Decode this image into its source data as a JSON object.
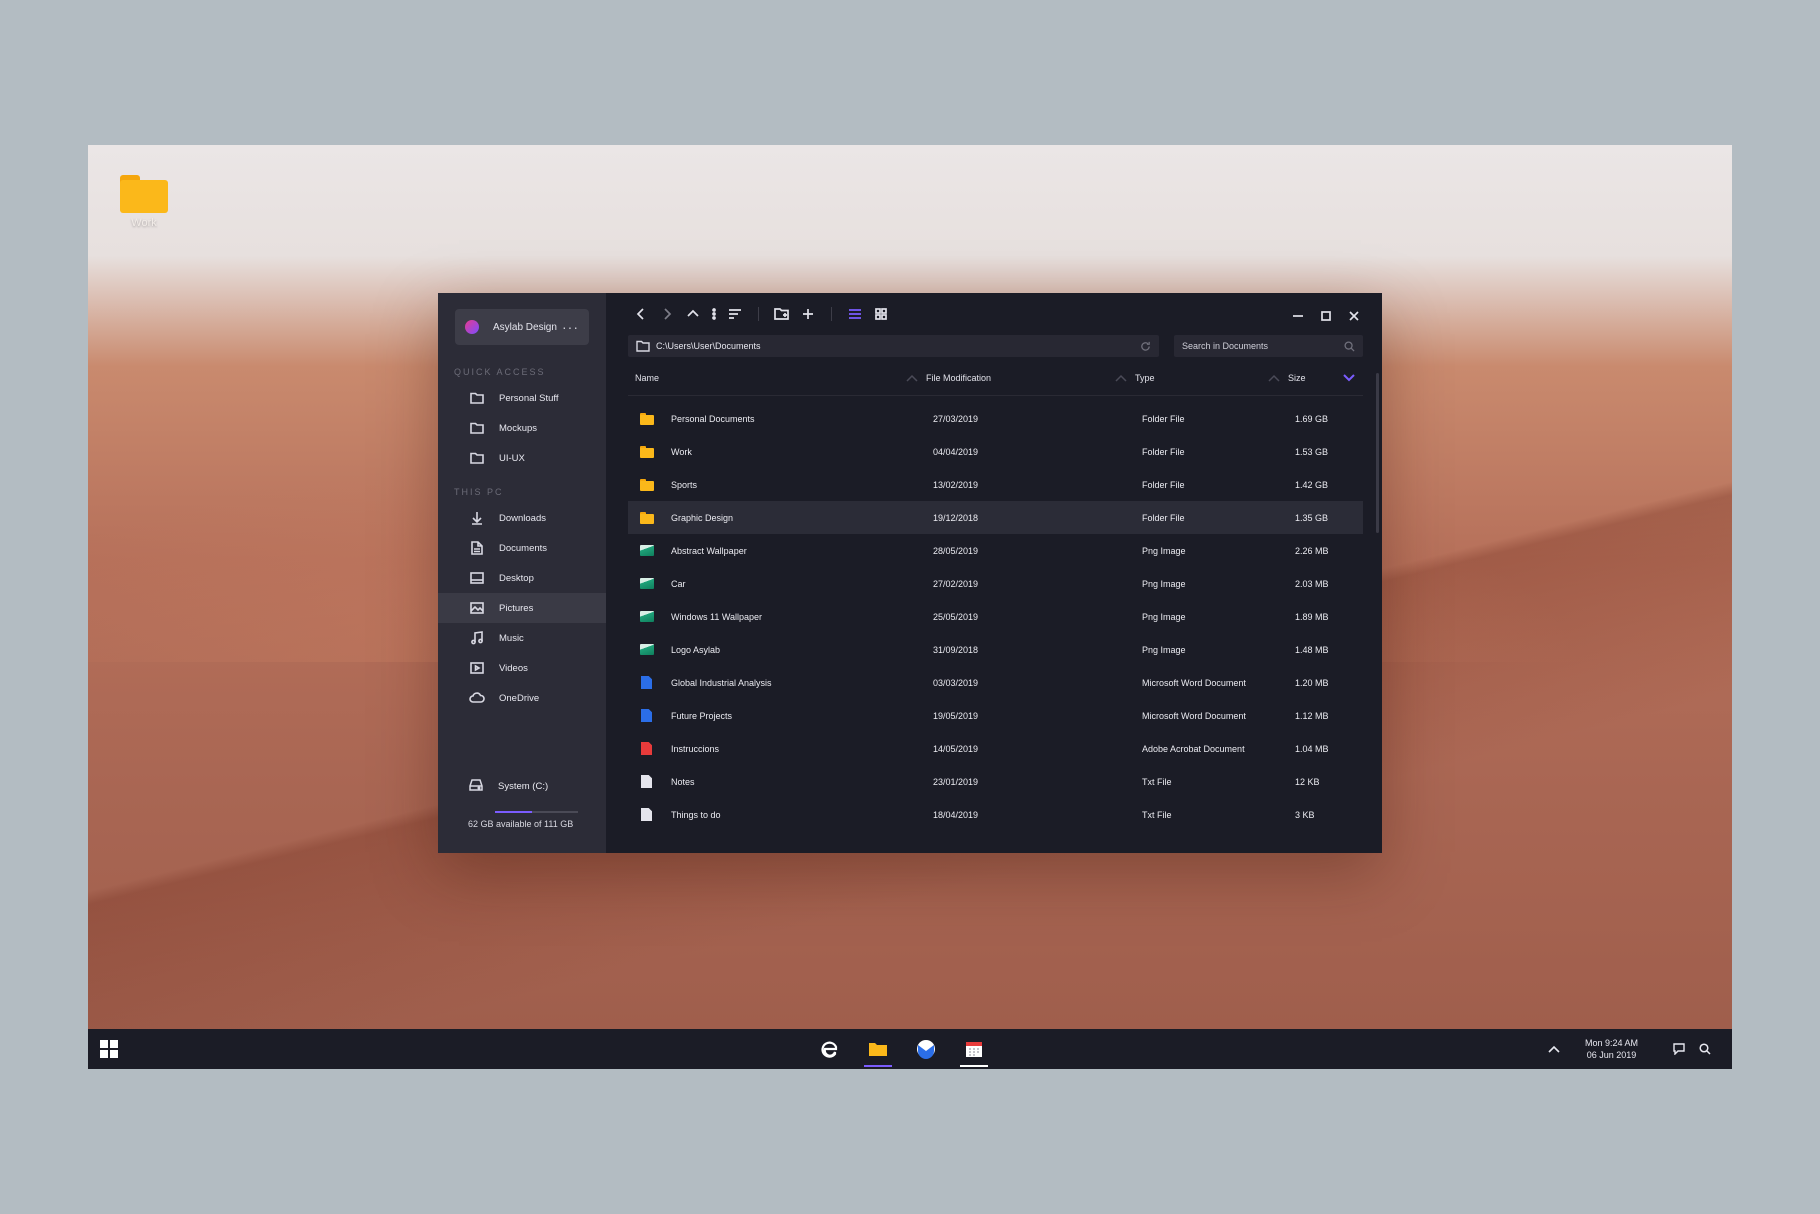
{
  "desktop": {
    "icons": [
      {
        "label": "Work",
        "icon": "folder-icon"
      }
    ]
  },
  "sidebar": {
    "account_name": "Asylab Design",
    "more": "···",
    "quick_access_title": "QUICK ACCESS",
    "quick_access": [
      {
        "label": "Personal Stuff",
        "icon": "folder-outline-icon"
      },
      {
        "label": "Mockups",
        "icon": "folder-outline-icon"
      },
      {
        "label": "UI-UX",
        "icon": "folder-outline-icon"
      }
    ],
    "this_pc_title": "THIS PC",
    "this_pc": [
      {
        "label": "Downloads",
        "icon": "download-icon"
      },
      {
        "label": "Documents",
        "icon": "document-icon"
      },
      {
        "label": "Desktop",
        "icon": "desktop-icon"
      },
      {
        "label": "Pictures",
        "icon": "pictures-icon",
        "active": true
      },
      {
        "label": "Music",
        "icon": "music-icon"
      },
      {
        "label": "Videos",
        "icon": "video-icon"
      },
      {
        "label": "OneDrive",
        "icon": "cloud-icon"
      }
    ],
    "drive": {
      "label": "System (C:)",
      "capacity": "62 GB available of 111 GB",
      "used_fraction": 0.44
    }
  },
  "address": {
    "path": "C:\\Users\\User\\Documents",
    "search_placeholder": "Search in Documents"
  },
  "columns": {
    "name": "Name",
    "date": "File Modification",
    "type": "Type",
    "size": "Size"
  },
  "files": [
    {
      "name": "Personal Documents",
      "date": "27/03/2019",
      "type": "Folder File",
      "size": "1.69 GB",
      "kind": "folder"
    },
    {
      "name": "Work",
      "date": "04/04/2019",
      "type": "Folder File",
      "size": "1.53 GB",
      "kind": "folder"
    },
    {
      "name": "Sports",
      "date": "13/02/2019",
      "type": "Folder File",
      "size": "1.42 GB",
      "kind": "folder"
    },
    {
      "name": "Graphic Design",
      "date": "19/12/2018",
      "type": "Folder File",
      "size": "1.35 GB",
      "kind": "folder",
      "selected": true
    },
    {
      "name": "Abstract Wallpaper",
      "date": "28/05/2019",
      "type": "Png Image",
      "size": "2.26 MB",
      "kind": "image"
    },
    {
      "name": "Car",
      "date": "27/02/2019",
      "type": "Png Image",
      "size": "2.03 MB",
      "kind": "image"
    },
    {
      "name": "Windows 11 Wallpaper",
      "date": "25/05/2019",
      "type": "Png Image",
      "size": "1.89 MB",
      "kind": "image"
    },
    {
      "name": "Logo Asylab",
      "date": "31/09/2018",
      "type": "Png Image",
      "size": "1.48 MB",
      "kind": "image"
    },
    {
      "name": "Global Industrial Analysis",
      "date": "03/03/2019",
      "type": "Microsoft Word Document",
      "size": "1.20 MB",
      "kind": "word"
    },
    {
      "name": "Future Projects",
      "date": "19/05/2019",
      "type": "Microsoft Word Document",
      "size": "1.12 MB",
      "kind": "word"
    },
    {
      "name": "Instruccions",
      "date": "14/05/2019",
      "type": "Adobe Acrobat Document",
      "size": "1.04 MB",
      "kind": "pdf"
    },
    {
      "name": "Notes",
      "date": "23/01/2019",
      "type": "Txt File",
      "size": "12 KB",
      "kind": "txt"
    },
    {
      "name": "Things to do",
      "date": "18/04/2019",
      "type": "Txt File",
      "size": "3 KB",
      "kind": "txt"
    }
  ],
  "taskbar": {
    "clock_time": "Mon 9:24 AM",
    "clock_date": "06 Jun 2019"
  },
  "colors": {
    "accent": "#7b5cff",
    "folder": "#fbb81a",
    "window_bg": "#1b1c26",
    "sidebar_bg": "#2c2c37"
  }
}
